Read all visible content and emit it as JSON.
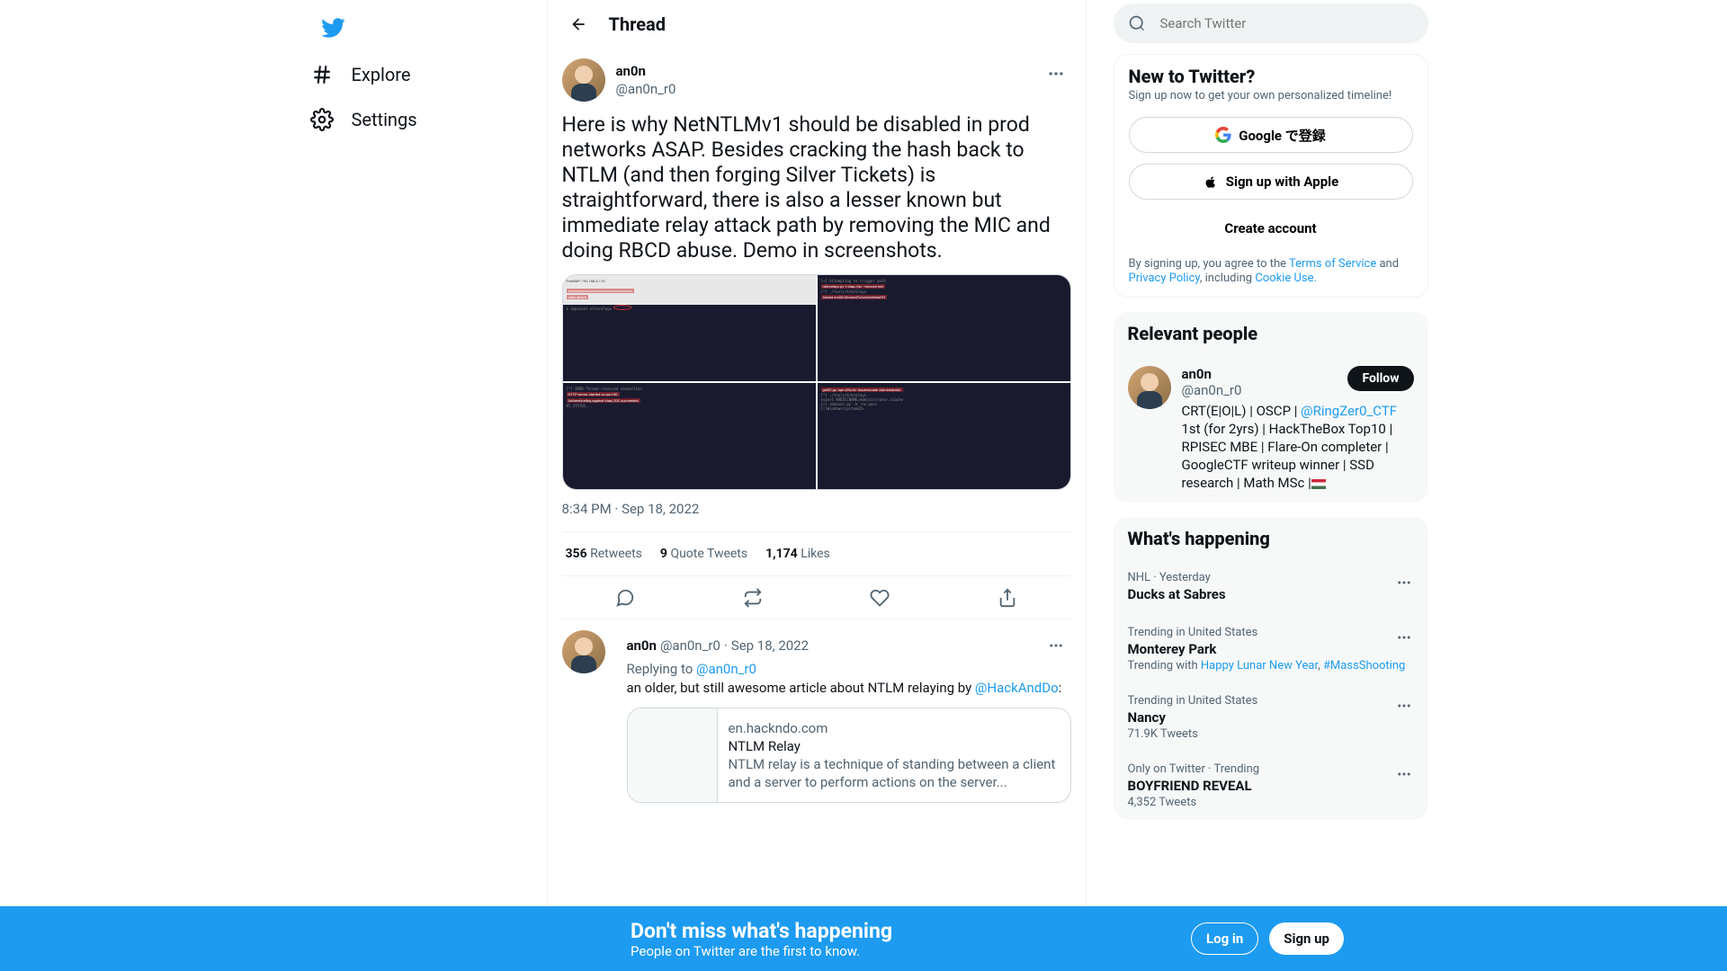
{
  "nav": {
    "explore": "Explore",
    "settings": "Settings"
  },
  "header": {
    "title": "Thread"
  },
  "search": {
    "placeholder": "Search Twitter"
  },
  "tweet": {
    "author_name": "an0n",
    "author_handle": "@an0n_r0",
    "text": "Here is why NetNTLMv1 should be disabled in prod networks ASAP. Besides cracking the hash back to NTLM (and then forging Silver Tickets) is straightforward, there is also a lesser known but immediate relay attack path by removing the MIC and doing RBCD abuse. Demo in screenshots.",
    "timestamp": "8:34 PM · Sep 18, 2022",
    "retweets_n": "356",
    "retweets_l": "Retweets",
    "quotes_n": "9",
    "quotes_l": "Quote Tweets",
    "likes_n": "1,174",
    "likes_l": "Likes"
  },
  "reply": {
    "author_name": "an0n",
    "author_handle": "@an0n_r0",
    "sep": "·",
    "date": "Sep 18, 2022",
    "replying_to_label": "Replying to ",
    "replying_to_handle": "@an0n_r0",
    "text_before": "an older, but still awesome article about NTLM relaying by ",
    "text_mention": "@HackAndDo",
    "text_after": ":",
    "card_domain": "en.hackndo.com",
    "card_title": "NTLM Relay",
    "card_desc": "NTLM relay is a technique of standing between a client and a server to perform actions on the server..."
  },
  "signup_card": {
    "title": "New to Twitter?",
    "sub": "Sign up now to get your own personalized timeline!",
    "google_btn": "Google で登録",
    "apple_btn": "Sign up with Apple",
    "create_btn": "Create account",
    "legal_1": "By signing up, you agree to the ",
    "legal_tos": "Terms of Service",
    "legal_2": " and ",
    "legal_pp": "Privacy Policy",
    "legal_3": ", including ",
    "legal_cookie": "Cookie Use.",
    "legal_4": ""
  },
  "relevant": {
    "title": "Relevant people",
    "name": "an0n",
    "handle": "@an0n_r0",
    "follow": "Follow",
    "bio_1": "CRT(E|O|L) | OSCP | ",
    "bio_link": "@RingZer0_CTF",
    "bio_2": " 1st (for 2yrs) | HackTheBox Top10 | RPISEC MBE | Flare-On completer | GoogleCTF writeup winner | SSD research | Math MSc |"
  },
  "happening": {
    "title": "What's happening",
    "items": [
      {
        "meta": "NHL · Yesterday",
        "title": "Ducks at Sabres",
        "sub": "",
        "sub_links": []
      },
      {
        "meta": "Trending in United States",
        "title": "Monterey Park",
        "sub": "Trending with ",
        "sub_links": [
          "Happy Lunar New Year",
          "#MassShooting"
        ]
      },
      {
        "meta": "Trending in United States",
        "title": "Nancy",
        "sub": "71.9K Tweets",
        "sub_links": []
      },
      {
        "meta": "Only on Twitter · Trending",
        "title": "BOYFRIEND REVEAL",
        "sub": "4,352 Tweets",
        "sub_links": []
      }
    ]
  },
  "banner": {
    "title": "Don't miss what's happening",
    "sub": "People on Twitter are the first to know.",
    "login": "Log in",
    "signup": "Sign up"
  }
}
